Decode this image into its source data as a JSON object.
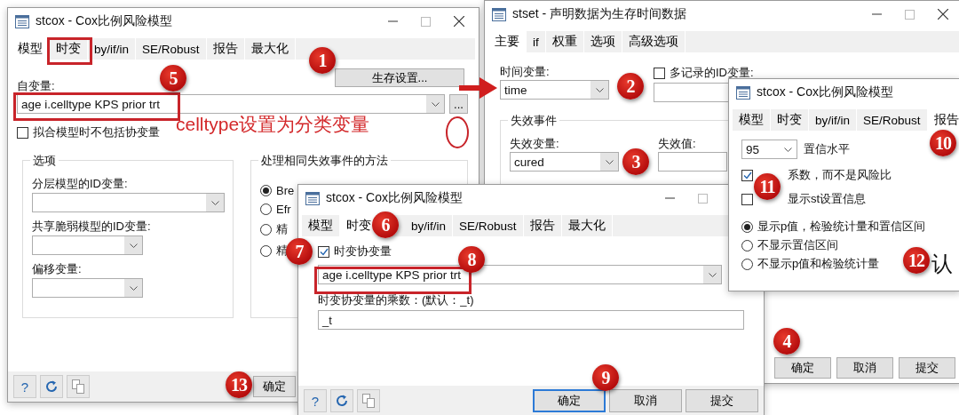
{
  "main_dialog": {
    "title": "stcox - Cox比例风险模型",
    "tabs": [
      {
        "label": "模型",
        "selected": true
      },
      {
        "label": "时变",
        "selected": false
      },
      {
        "label": "by/if/in",
        "selected": false
      },
      {
        "label": "SE/Robust",
        "selected": false
      },
      {
        "label": "报告",
        "selected": false
      },
      {
        "label": "最大化",
        "selected": false
      }
    ],
    "survival_settings_button": "生存设置...",
    "independent_vars": {
      "label": "自变量:",
      "value": "age i.celltype KPS prior trt"
    },
    "browse_button": "...",
    "exclude_covariates": {
      "label": "拟合模型时不包括协变量",
      "checked": false
    },
    "options_group": {
      "title": "选项",
      "fields": [
        {
          "label": "分层模型的ID变量:"
        },
        {
          "label": "共享脆弱模型的ID变量:"
        },
        {
          "label": "偏移变量:"
        }
      ]
    },
    "ties_group": {
      "title": "处理相同失效事件的方法",
      "options": [
        {
          "label": "Bre",
          "selected": true
        },
        {
          "label": "Efr",
          "selected": false
        },
        {
          "label": "精",
          "selected": false
        },
        {
          "label": "精",
          "selected": false
        }
      ]
    },
    "help_button": "?",
    "ok_button": "确定"
  },
  "stset_dialog": {
    "title": "stset - 声明数据为生存时间数据",
    "tabs": [
      {
        "label": "主要",
        "selected": true
      },
      {
        "label": "if",
        "selected": false
      },
      {
        "label": "权重",
        "selected": false
      },
      {
        "label": "选项",
        "selected": false
      },
      {
        "label": "高级选项",
        "selected": false
      }
    ],
    "time_var": {
      "label": "时间变量:",
      "value": "time"
    },
    "multi_record_id": {
      "label": "多记录的ID变量:",
      "checked": false
    },
    "failure_group": {
      "title": "失效事件",
      "failure_var": {
        "label": "失效变量:",
        "value": "cured"
      },
      "failure_value": {
        "label": "失效值:"
      }
    },
    "buttons": [
      "确定",
      "取消",
      "提交"
    ]
  },
  "timevar_dialog": {
    "title": "stcox - Cox比例风险模型",
    "tabs": [
      {
        "label": "模型",
        "selected": false
      },
      {
        "label": "时变",
        "selected": true
      },
      {
        "label": "by/if/in",
        "selected": false
      },
      {
        "label": "SE/Robust",
        "selected": false
      },
      {
        "label": "报告",
        "selected": false
      },
      {
        "label": "最大化",
        "selected": false
      }
    ],
    "tvc": {
      "label": "时变协变量",
      "checked": true
    },
    "tvc_vars": {
      "value": "age i.celltype KPS prior trt"
    },
    "multiplier": {
      "label": "时变协变量的乘数：(默认：_t)",
      "value": "_t"
    },
    "help_button": "?",
    "buttons": [
      "确定",
      "取消",
      "提交"
    ]
  },
  "report_dialog": {
    "title": "stcox - Cox比例风险模型",
    "tabs": [
      {
        "label": "模型",
        "selected": false
      },
      {
        "label": "时变",
        "selected": false
      },
      {
        "label": "by/if/in",
        "selected": false
      },
      {
        "label": "SE/Robust",
        "selected": false
      },
      {
        "label": "报告",
        "selected": true
      }
    ],
    "confidence": {
      "value": "95",
      "label": "置信水平"
    },
    "checkboxes": [
      {
        "label": "系数，而不是风险比",
        "checked": true
      },
      {
        "label": "显示st设置信息",
        "checked": false
      }
    ],
    "radios": [
      {
        "label": "显示p值，检验统计量和置信区间",
        "selected": true
      },
      {
        "label": "不显示置信区间",
        "selected": false
      },
      {
        "label": "不显示p值和检验统计量",
        "selected": false
      }
    ]
  },
  "annotations": {
    "note": "celltype设置为分类变量",
    "confirm_text": "认",
    "badges": [
      "1",
      "2",
      "3",
      "4",
      "5",
      "6",
      "7",
      "8",
      "9",
      "10",
      "11",
      "12",
      "13"
    ]
  }
}
